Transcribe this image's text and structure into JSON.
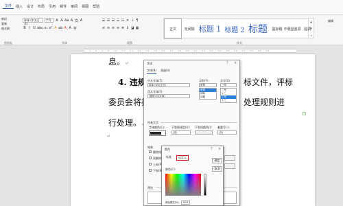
{
  "menu": {
    "tabs": [
      "文件",
      "插入",
      "设计",
      "布局",
      "引用",
      "邮件",
      "审阅",
      "视图",
      "帮助"
    ],
    "active_index": 0
  },
  "clipboard": {
    "cut": "剪切",
    "copy": "复制",
    "paste_format": "格式刷"
  },
  "font": {
    "name": "宋体 (中文正文)",
    "size": "二号"
  },
  "toolbar_row1": [
    "A",
    "A",
    "Aa",
    "A",
    "文",
    "A"
  ],
  "toolbar_row2": [
    "B",
    "I",
    "U",
    "abc",
    "x₂",
    "x²",
    "A",
    "ab",
    "A",
    "A",
    "字"
  ],
  "para_row1": [
    "☰",
    "☰",
    "☰",
    "☷",
    "☷",
    "✕",
    "↓",
    "¶"
  ],
  "para_row2": [
    "≡",
    "≡",
    "≡",
    "≡",
    "≣",
    "↕",
    "◪",
    "▦"
  ],
  "styles": {
    "items": [
      {
        "label": "正文",
        "type": "normal"
      },
      {
        "label": "无间隔",
        "type": "small"
      },
      {
        "label": "标题 1",
        "type": "h1"
      },
      {
        "label": "标题 2",
        "type": "h2"
      },
      {
        "label": "标题",
        "type": "title"
      },
      {
        "label": "副标题",
        "type": "small"
      },
      {
        "label": "不明显强调",
        "type": "small"
      },
      {
        "label": "强调",
        "type": "small"
      }
    ],
    "extra": [
      "编辑"
    ]
  },
  "group_labels": {
    "clipboard": "剪贴板",
    "font": "字体",
    "paragraph": "段落",
    "styles": "样式"
  },
  "ruler_text": "L · 2 · 4 · 6 · 8 · 10 · 12 · 14 · 16 · 18 · 20 · 22 · 24 · 26 · 28 · 30 · 32 · 34 · 36 · 38 · 40 · 42 · 44 · 46 · 48",
  "document": {
    "line1": "息。",
    "line2_left": "4. 违规处",
    "line2_right": "标文件，评标",
    "line3_left": "委员会将按照",
    "line3_right": "处理规则进",
    "line4": "行处理。",
    "return_mark": "↵"
  },
  "font_dialog": {
    "title": "字体",
    "tabs": [
      "字体(N)",
      "高级(V)"
    ],
    "chinese_font_label": "中文字体(T):",
    "chinese_font_value": "宋体 (中文正文)",
    "western_font_label": "西文字体(F):",
    "western_font_value": "(使用中文字体)",
    "style_label": "字形(Y):",
    "style_value": "常规",
    "style_list": [
      "常规",
      "倾斜",
      "加粗"
    ],
    "style_selected": 0,
    "size_label": "字号(S):",
    "size_value": "三号",
    "size_list": [
      "二号",
      "小二",
      "三号",
      "小三"
    ],
    "size_selected": 2,
    "all_text_label": "所有文字",
    "font_color_label": "字体颜色(C):",
    "underline_label": "下划线线型(U):",
    "underline_value": "(无)",
    "underline_color_label": "下划线颜色(I):",
    "emphasis_label": "着重号(·):",
    "emphasis_value": "(无)",
    "effects_label": "效果",
    "effects": [
      "删除线(K)",
      "双删除线(L)",
      "上标(P)",
      "下标(B)"
    ],
    "preview_label": "预览",
    "close_glyph": "×",
    "help_glyph": "?"
  },
  "color_dialog": {
    "title": "颜色",
    "tabs": [
      "标准",
      "自定义"
    ],
    "active_tab": 1,
    "colors_label": "颜色(C):",
    "ok": "确定",
    "cancel": "取消",
    "model_label": "颜色模式(D):",
    "model_value": "RGB",
    "help_glyph": "?",
    "close_glyph": "×"
  }
}
